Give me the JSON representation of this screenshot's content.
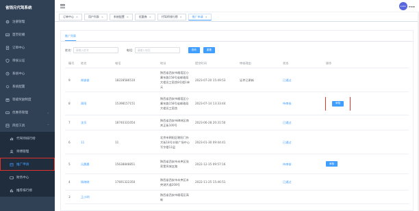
{
  "sidebar": {
    "title": "省钱兄代驾系统",
    "items": [
      {
        "label": "注册管理",
        "icon": "gear-icon"
      },
      {
        "label": "首页轮播",
        "icon": "image-icon"
      },
      {
        "label": "订单中心",
        "icon": "clipboard-icon"
      },
      {
        "label": "审核认证",
        "icon": "shield-icon"
      },
      {
        "label": "系统中心",
        "icon": "settings-icon"
      },
      {
        "label": "系统配置",
        "icon": "cog-icon"
      },
      {
        "label": "等级奖励制度",
        "icon": "gift-icon"
      },
      {
        "label": "优惠券管理",
        "icon": "ticket-icon"
      },
      {
        "label": "风控工具",
        "icon": "tools-icon"
      }
    ],
    "sub_items": [
      {
        "label": "代驾师排行榜",
        "icon": "bar-chart-icon"
      },
      {
        "label": "师傅管理",
        "icon": "user-icon"
      },
      {
        "label": "推广申请",
        "icon": "promotion-icon"
      },
      {
        "label": "财务中心",
        "icon": "wallet-icon"
      },
      {
        "label": "推荐排行榜",
        "icon": "rank-icon"
      }
    ]
  },
  "header": {
    "username": "mew",
    "avatar_text": "avatar"
  },
  "tabs": [
    {
      "label": "订单中心"
    },
    {
      "label": "用户列表"
    },
    {
      "label": "系统配置"
    },
    {
      "label": "优惠券"
    },
    {
      "label": "代驾师排行榜"
    },
    {
      "label": "推广申请",
      "active": true
    }
  ],
  "main": {
    "section_tag": "推广列表",
    "search": {
      "name_label": "姓名:",
      "name_placeholder": "请输入姓名",
      "phone_label": "电话:",
      "phone_placeholder": "请输入电话",
      "query_button": "查询",
      "reset_button": "重置"
    },
    "table": {
      "headers": [
        "编号",
        "姓名",
        "电话",
        "地址",
        "提交时间",
        "审核理由",
        "状态",
        "操作"
      ],
      "rows": [
        {
          "id": "9",
          "name": "胡俊俊",
          "phone": "18228586510",
          "address": "陕西省西安市雁塔区小寨东路158号省邮政局大楼员工宿舍8号楼1单元",
          "time": "2023-07-20 15:49:53",
          "reason": "证件已更新",
          "status": "已通过",
          "op": ""
        },
        {
          "id": "8",
          "name": "周雨",
          "phone": "15398157151",
          "address": "陕西省西安市雁塔区小寨东路158号省邮政局大楼员工宿舍",
          "time": "2023-07-14 13:33:44",
          "reason": "",
          "status": "待审核",
          "op": "审核"
        },
        {
          "id": "7",
          "name": "沈乐",
          "phone": "18740331054",
          "address": "陕西省西安市碑林区南关正街100号",
          "time": "2023-06-28 20:31:50",
          "reason": "",
          "status": "已通过",
          "op": ""
        },
        {
          "id": "6",
          "name": "11",
          "phone": "11",
          "address": "北京市朝阳区朝阳门外大街18号丰联广场中心写字楼11层",
          "time": "2023-01-30 09:44:41",
          "reason": "",
          "status": "已通过",
          "op": ""
        },
        {
          "id": "5",
          "name": "吕晨晨",
          "phone": "15638848851",
          "address": "陕西省西安市未央区张家堡凤城五路",
          "time": "2022-12-15 09:57:16",
          "reason": "",
          "status": "待审核",
          "op": "审核"
        },
        {
          "id": "4",
          "name": "杨晓晓",
          "phone": "17691322350",
          "address": "陕西省西安市未央区未央湖大道208号",
          "time": "2022-11-25 15:46:51",
          "reason": "",
          "status": "已通过",
          "op": ""
        },
        {
          "id": "3",
          "name": "王小明",
          "phone": "",
          "address": "陕西省西安市雁塔区高新",
          "time": "",
          "reason": "",
          "status": "",
          "op": ""
        }
      ]
    }
  },
  "colors": {
    "sidebar_bg": "#304156",
    "accent": "#409eff",
    "highlight": "#e3322e"
  }
}
